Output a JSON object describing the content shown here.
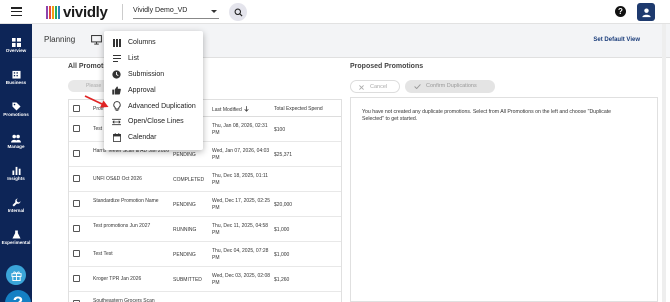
{
  "topbar": {
    "logo_text": "vividly",
    "logo_stripes": [
      "#8e44ad",
      "#e74c3c",
      "#f39c12",
      "#27ae60",
      "#2980b9"
    ],
    "org_selector_value": "Vividly Demo_VD",
    "help_icon_text": "?"
  },
  "sidebar": {
    "items": [
      {
        "label": "Overview",
        "icon": "grid-icon"
      },
      {
        "label": "Business",
        "icon": "business-icon"
      },
      {
        "label": "Promotions",
        "icon": "tag-icon"
      },
      {
        "label": "Manage",
        "icon": "people-icon"
      },
      {
        "label": "Insights",
        "icon": "bar-chart-icon"
      },
      {
        "label": "Internal",
        "icon": "wrench-icon"
      },
      {
        "label": "Experimental",
        "icon": "flask-icon"
      }
    ],
    "help_fab_text": "?"
  },
  "planning": {
    "title": "Planning",
    "set_default_view": "Set Default View"
  },
  "left_panel": {
    "title": "All Promotions",
    "please_button_label": "Please",
    "columns": {
      "name": "Promotion",
      "status": "",
      "last_modified": "Last Modified",
      "total_spend": "Total Expected Spend"
    },
    "rows": [
      {
        "name": "Test",
        "status": "",
        "modified": "Thu, Jan 08, 2026, 02:31 PM",
        "spend": "$100"
      },
      {
        "name": "Harris Teeter Scan & AD Jan 2026",
        "status": "PENDING",
        "modified": "Wed, Jan 07, 2026, 04:03 PM",
        "spend": "$25,371"
      },
      {
        "name": "UNFI OS&D Oct 2026",
        "status": "COMPLETED",
        "modified": "Thu, Dec 18, 2025, 01:11 PM",
        "spend": ""
      },
      {
        "name": "Standardize Promotion Name",
        "status": "PENDING",
        "modified": "Wed, Dec 17, 2025, 02:25 PM",
        "spend": "$20,000"
      },
      {
        "name": "Test promotions Jun 2027",
        "status": "RUNNING",
        "modified": "Thu, Dec 11, 2025, 04:58 PM",
        "spend": "$1,000"
      },
      {
        "name": "Test Test",
        "status": "PENDING",
        "modified": "Thu, Dec 04, 2025, 07:28 PM",
        "spend": "$1,000"
      },
      {
        "name": "Kroger TPR Jan 2026",
        "status": "SUBMITTED",
        "modified": "Wed, Dec 03, 2025, 02:08 PM",
        "spend": "$1,260"
      },
      {
        "name": "Southeastern Grocers Scan",
        "status": "",
        "modified": "",
        "spend": ""
      }
    ]
  },
  "right_panel": {
    "title": "Proposed Promotions",
    "cancel_label": "Cancel",
    "confirm_label": "Confirm Duplications",
    "empty_message": "You have not created any duplicate promotions. Select from All Promotions on the left and choose \"Duplicate Selected\" to get started."
  },
  "menu": {
    "items": [
      {
        "label": "Columns",
        "icon": "columns-icon"
      },
      {
        "label": "List",
        "icon": "list-icon"
      },
      {
        "label": "Submission",
        "icon": "clock-icon"
      },
      {
        "label": "Approval",
        "icon": "thumbs-up-icon"
      },
      {
        "label": "Advanced Duplication",
        "icon": "lightbulb-icon"
      },
      {
        "label": "Open/Close Lines",
        "icon": "open-close-icon"
      },
      {
        "label": "Calendar",
        "icon": "calendar-icon"
      }
    ]
  },
  "colors": {
    "sidebar_bg": "#0d2557",
    "link_blue": "#1a3c7a",
    "fab_blue": "#1580c4",
    "gift_blue": "#3aa4d8",
    "arrow_red": "#e02424"
  }
}
